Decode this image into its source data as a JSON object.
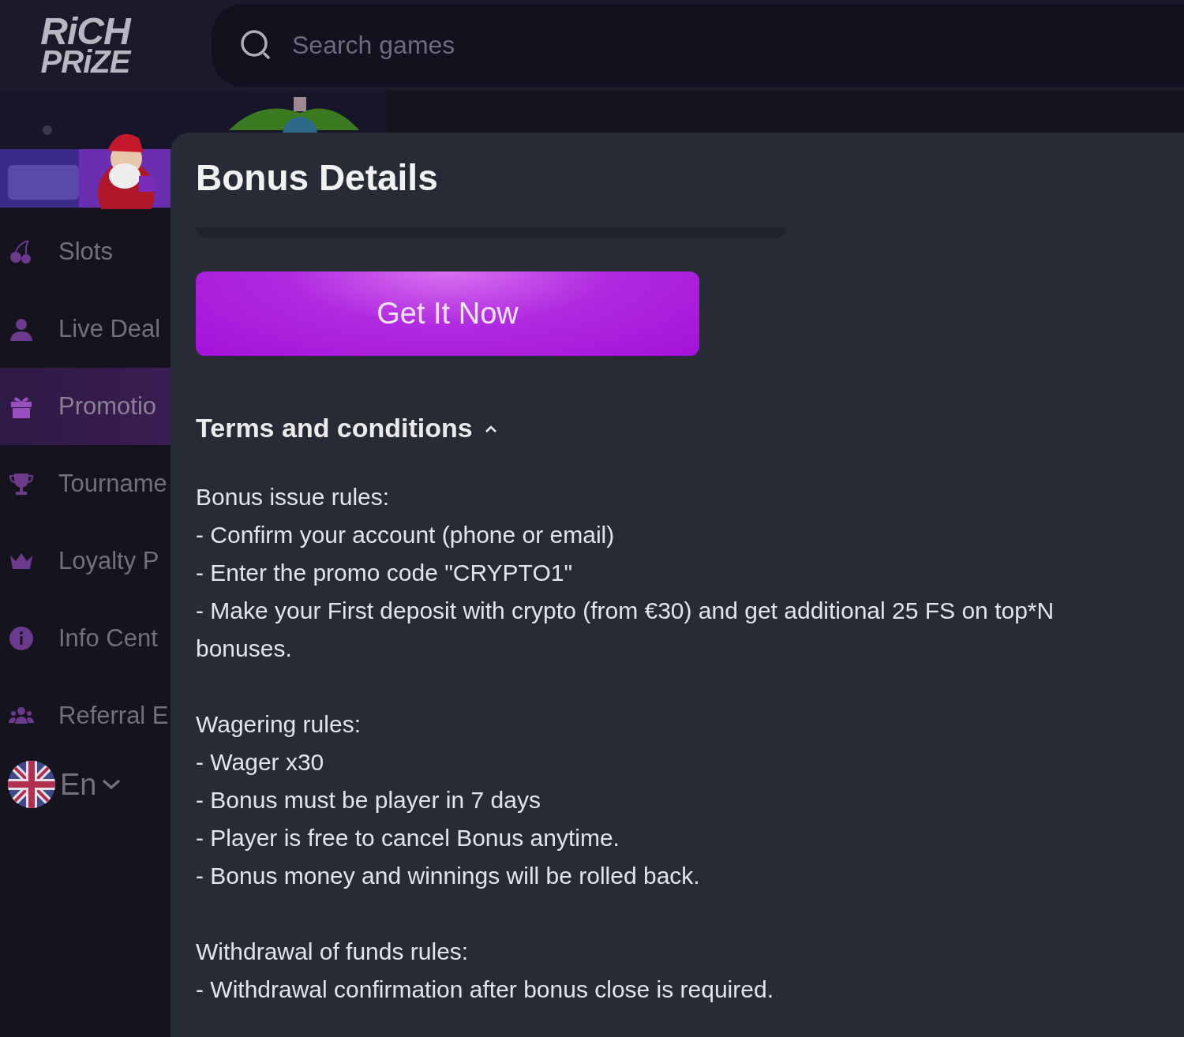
{
  "logo": {
    "line_1": "RiCH",
    "line_2": "PRiZE"
  },
  "search": {
    "placeholder": "Search games"
  },
  "sidebar": {
    "items": [
      {
        "label": "Slots",
        "selected": false
      },
      {
        "label": "Live Deal",
        "selected": false
      },
      {
        "label": "Promotio",
        "selected": true
      },
      {
        "label": "Tourname",
        "selected": false
      },
      {
        "label": "Loyalty P",
        "selected": false
      },
      {
        "label": "Info Cent",
        "selected": false
      },
      {
        "label": "Referral E",
        "selected": false
      }
    ],
    "language": {
      "label": "En"
    }
  },
  "modal": {
    "title": "Bonus Details",
    "button": "Get It Now",
    "terms": {
      "heading": "Terms and conditions",
      "expanded": true,
      "sections": [
        {
          "lines": [
            "Bonus issue rules:",
            "- Confirm your account (phone or email)",
            "- Enter the promo code \"CRYPTO1\"",
            "- Make your First deposit with crypto (from €30) and get additional 25 FS on top*N",
            "bonuses."
          ]
        },
        {
          "lines": [
            "Wagering rules:",
            "- Wager x30",
            "- Bonus must be player in 7 days",
            "- Player is free to cancel Bonus anytime.",
            "- Bonus money and winnings will be rolled back."
          ]
        },
        {
          "lines": [
            "Withdrawal of funds rules:",
            "- Withdrawal confirmation after bonus close is required."
          ]
        }
      ]
    }
  }
}
